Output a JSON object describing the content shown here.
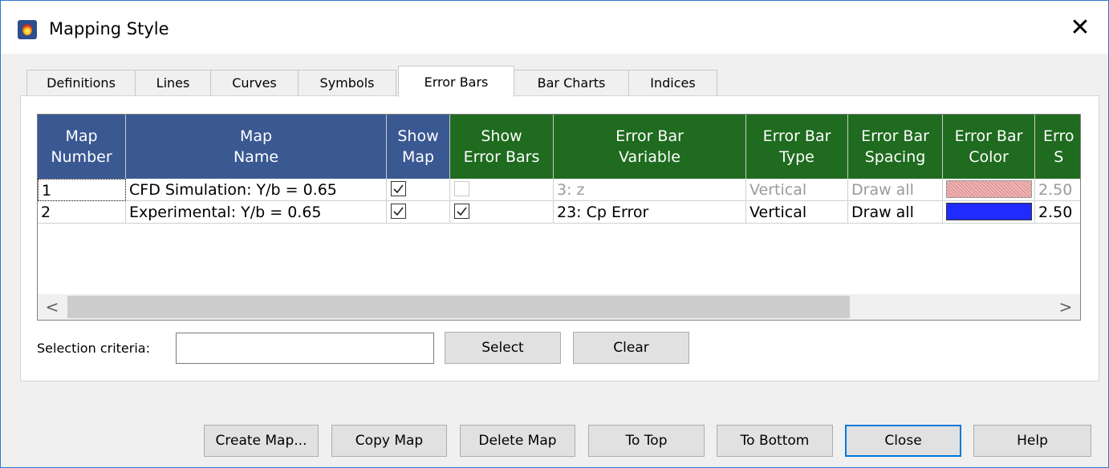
{
  "window": {
    "title": "Mapping Style",
    "close_glyph": "✕"
  },
  "tabs": [
    {
      "label": "Definitions"
    },
    {
      "label": "Lines"
    },
    {
      "label": "Curves"
    },
    {
      "label": "Symbols"
    },
    {
      "label": "Error Bars",
      "active": true
    },
    {
      "label": "Bar Charts"
    },
    {
      "label": "Indices"
    }
  ],
  "grid": {
    "headers": [
      {
        "label": "Map\nNumber",
        "color": "#3a5892"
      },
      {
        "label": "Map\nName",
        "color": "#3a5892"
      },
      {
        "label": "Show\nMap",
        "color": "#3a5892"
      },
      {
        "label": "Show\nError Bars",
        "color": "#1f6b1f"
      },
      {
        "label": "Error Bar\nVariable",
        "color": "#1f6b1f"
      },
      {
        "label": "Error Bar\nType",
        "color": "#1f6b1f"
      },
      {
        "label": "Error Bar\nSpacing",
        "color": "#1f6b1f"
      },
      {
        "label": "Error Bar\nColor",
        "color": "#1f6b1f"
      },
      {
        "label": "Erro\nS",
        "color": "#1f6b1f"
      }
    ],
    "rows": [
      {
        "number": "1",
        "name": "CFD Simulation: Y/b = 0.65",
        "show_map": true,
        "show_error_bars": false,
        "variable": "3: z",
        "type": "Vertical",
        "spacing": "Draw all",
        "color": "#f2b6b6",
        "size": "2.50",
        "dimmed": true
      },
      {
        "number": "2",
        "name": "Experimental: Y/b = 0.65",
        "show_map": true,
        "show_error_bars": true,
        "variable": "23: Cp Error",
        "type": "Vertical",
        "spacing": "Draw all",
        "color": "#1f2bff",
        "size": "2.50",
        "dimmed": false
      }
    ],
    "scroll_left_glyph": "<",
    "scroll_right_glyph": ">"
  },
  "selection": {
    "label": "Selection criteria:",
    "value": "",
    "select_label": "Select",
    "clear_label": "Clear"
  },
  "footer_buttons": [
    {
      "label": "Create Map..."
    },
    {
      "label": "Copy Map"
    },
    {
      "label": "Delete Map"
    },
    {
      "label": "To Top"
    },
    {
      "label": "To Bottom"
    },
    {
      "label": "Close",
      "default": true
    },
    {
      "label": "Help"
    }
  ]
}
